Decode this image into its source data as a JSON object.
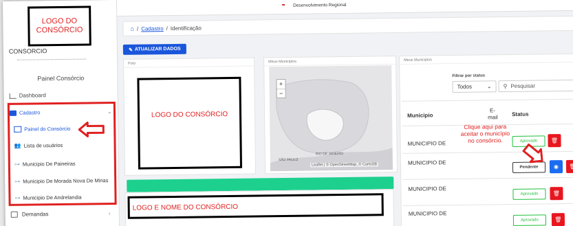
{
  "sidebar": {
    "logo_text": "LOGO DO CONSÓRCIO",
    "org_label": "CONSORCIO",
    "panel_title": "Painel Consórcio",
    "dashboard_label": "Dashboard",
    "cadastro_label": "Cadastro",
    "items": [
      {
        "label": "Painel do Consórcio"
      },
      {
        "label": "Lista de usuários"
      },
      {
        "label": "Municipio De Paineiras"
      },
      {
        "label": "Municipio De Morada Nova De Minas"
      },
      {
        "label": "Municipio De Andrelandia"
      }
    ],
    "demandas_label": "Demandas"
  },
  "topbar": {
    "text": "Desenvolvimento Regional"
  },
  "breadcrumb": {
    "link": "Cadastro",
    "separator": "/",
    "current": "Identificação"
  },
  "toolbar": {
    "update_label": "ATUALIZAR DADOS"
  },
  "cards": {
    "foto_title": "Foto",
    "mapa_title": "Meus Municipios",
    "lista_title": "Meus Municipios"
  },
  "foto_logo_text": "LOGO DO CONSÓRCIO",
  "map": {
    "attribution": "Leaflet | © OpenStreetMap, © CartoDB",
    "label_rio": "RIO DE JANEIRO",
    "label_sp": "SÃO PAULO",
    "zoom_in": "+",
    "zoom_out": "−"
  },
  "nome_box_text": "LOGO E NOME DO CONSÓRCIO",
  "filter": {
    "label": "Filtrar por status",
    "selected": "Todos",
    "search_placeholder": "Pesquisar"
  },
  "table": {
    "headers": {
      "municipio": "Municipio",
      "email_top": "E-",
      "email_bottom": "mail",
      "status": "Status"
    },
    "rows": [
      {
        "municipio": "MUNICIPIO DE",
        "status": "Aprovado"
      },
      {
        "municipio": "MUNICIPIO DE",
        "status": "Pendente"
      },
      {
        "municipio": "MUNICIPIO DE",
        "status": "Aprovado"
      },
      {
        "municipio": "MUNICIPIO DE",
        "status": "Aprovado"
      }
    ]
  },
  "annotation": {
    "line1": "Clique aqui para",
    "line2": "aceitar o município",
    "line3": "no consórcio."
  },
  "colors": {
    "accent": "#1a56db",
    "annot_red": "#e02020",
    "approve_green": "#1fbf3a",
    "green_bar": "#1dd08e",
    "danger": "#e8171f"
  }
}
